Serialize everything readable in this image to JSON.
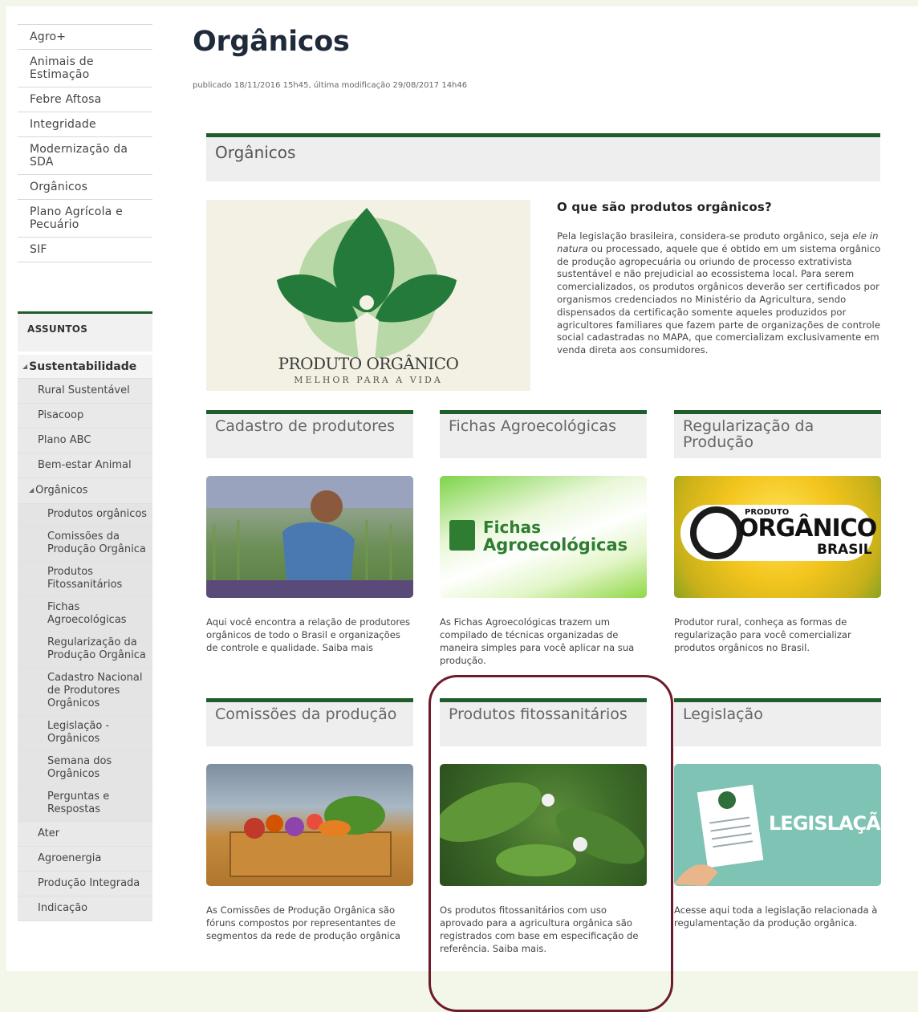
{
  "sidebar": {
    "top_items": [
      {
        "label": "Agro+"
      },
      {
        "label": "Animais de Estimação"
      },
      {
        "label": "Febre Aftosa"
      },
      {
        "label": "Integridade"
      },
      {
        "label": "Modernização da SDA"
      },
      {
        "label": "Orgânicos"
      },
      {
        "label": "Plano Agrícola e Pecuário"
      },
      {
        "label": "SIF"
      }
    ],
    "assuntos_label": "ASSUNTOS",
    "subjects": {
      "sustentabilidade": "Sustentabilidade",
      "rural_sustentavel": "Rural Sustentável",
      "pisacoop": "Pisacoop",
      "plano_abc": "Plano ABC",
      "bem_estar": "Bem-estar Animal",
      "organicos": "Orgânicos",
      "produtos_organicos": "Produtos orgânicos",
      "comissoes": "Comissões da Produção Orgânica",
      "fitossanitarios": "Produtos Fitossanitários",
      "fichas": "Fichas Agroecológicas",
      "regularizacao": "Regularização da Produção Orgânica",
      "cadastro": "Cadastro Nacional de Produtores Orgânicos",
      "legislacao": "Legislação - Orgânicos",
      "semana": "Semana dos Orgânicos",
      "perguntas": "Perguntas e Respostas",
      "ater": "Ater",
      "agroenergia": "Agroenergia",
      "producao_integrada": "Produção Integrada",
      "indicacao": "Indicação"
    }
  },
  "main": {
    "title": "Orgânicos",
    "meta": "publicado 18/11/2016 15h45, última modificação 29/08/2017 14h46",
    "section_bar": "Orgânicos",
    "hero": {
      "line1": "PRODUTO ORGÂNICO",
      "line2": "MELHOR PARA A VIDA"
    },
    "intro": {
      "heading": "O que são produtos orgânicos?",
      "text_before": "Pela legislação brasileira, considera-se produto orgânico, seja ",
      "text_em": "ele in natura",
      "text_after": " ou processado, aquele que é obtido em um sistema orgânico de produção agropecuária ou oriundo de processo extrativista sustentável e não prejudicial ao ecossistema local. Para serem comercializados, os produtos orgânicos deverão ser certificados por organismos credenciados no Ministério da Agricultura, sendo dispensados da certificação somente aqueles produzidos por agricultores familiares que fazem parte de organizações de controle social cadastradas no MAPA, que comercializam exclusivamente em venda direta aos consumidores."
    },
    "cards": [
      {
        "title": "Cadastro de produtores",
        "desc": "Aqui você encontra a relação de produtores orgânicos de todo o Brasil e organizações de controle e qualidade. Saiba mais"
      },
      {
        "title": "Fichas Agroecológicas",
        "desc": "As Fichas Agroecológicas trazem um compilado de técnicas organizadas de maneira simples para você aplicar na sua produção.",
        "img_text_1": "Fichas",
        "img_text_2": "Agroecológicas"
      },
      {
        "title": "Regularização da Produção",
        "desc": "Produtor rural, conheça as formas de regularização para você comercializar produtos orgânicos no Brasil.",
        "img_text_1": "PRODUTO",
        "img_text_2": "ORGÂNICO",
        "img_text_3": "BRASIL"
      },
      {
        "title": "Comissões da produção",
        "desc": "As Comissões de Produção Orgânica são fóruns compostos por representantes de segmentos da rede de produção orgânica"
      },
      {
        "title": "Produtos fitossanitários",
        "desc": "Os produtos fitossanitários com uso aprovado para a agricultura orgânica são registrados com base em especificação de referência. Saiba mais."
      },
      {
        "title": "Legislação",
        "desc": "Acesse aqui toda a legislação relacionada à regulamentação da produção orgânica.",
        "img_text_1": "LEGISLAÇÃO"
      }
    ]
  },
  "colors": {
    "accent_green": "#1d5e2b",
    "highlight_border": "#6d1a2a",
    "page_bg": "#f3f7ea"
  }
}
